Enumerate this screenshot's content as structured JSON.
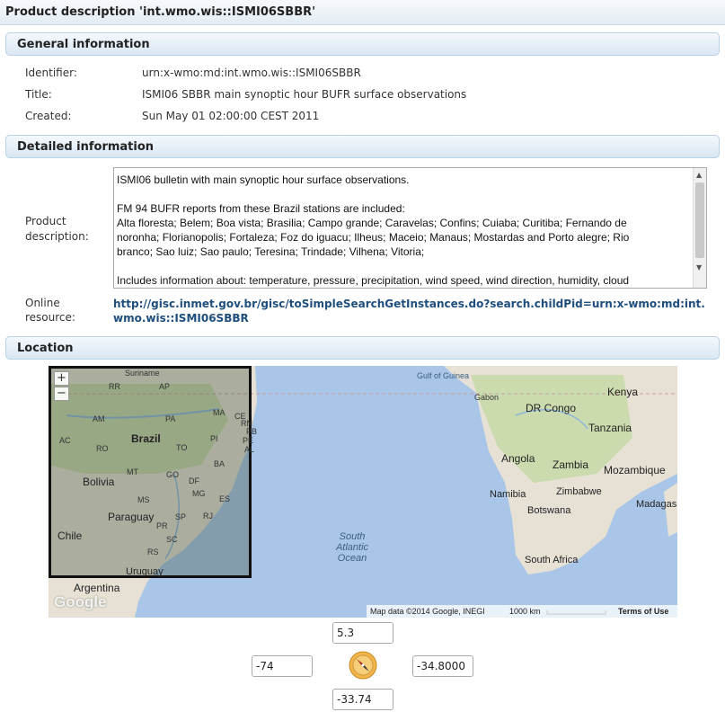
{
  "page": {
    "title": "Product description 'int.wmo.wis::ISMI06SBBR'"
  },
  "general": {
    "heading": "General information",
    "identifier_label": "Identifier:",
    "identifier_value": "urn:x-wmo:md:int.wmo.wis::ISMI06SBBR",
    "title_label": "Title:",
    "title_value": "ISMI06 SBBR main synoptic hour BUFR surface observations",
    "created_label": "Created:",
    "created_value": "Sun May 01 02:00:00 CEST 2011"
  },
  "detailed": {
    "heading": "Detailed information",
    "description_label_1": "Product",
    "description_label_2": "description:",
    "description_lines": [
      "ISMI06 bulletin with main synoptic hour surface observations.",
      "",
      "FM 94 BUFR reports from these Brazil stations are included:",
      "Alta floresta; Belem; Boa vista; Brasilia; Campo grande; Caravelas; Confins; Cuiaba; Curitiba; Fernando de",
      "noronha; Florianopolis; Fortaleza; Foz do iguacu; Ilheus; Maceio; Manaus; Mostardas and Porto alegre; Rio",
      "branco; Sao luiz; Sao paulo; Teresina; Trindade; Vilhena; Vitoria;",
      "",
      "Includes information about: temperature, pressure, precipitation, wind speed, wind direction, humidity, cloud"
    ],
    "online_label_1": "Online",
    "online_label_2": "resource:",
    "online_url": "http://gisc.inmet.gov.br/gisc/toSimpleSearchGetInstances.do?search.childPid=urn:x-wmo:md:int.wmo.wis::ISMI06SBBR"
  },
  "location": {
    "heading": "Location",
    "map": {
      "labels": {
        "suriname": "Suriname",
        "rr": "RR",
        "ap": "AP",
        "am": "AM",
        "pa": "PA",
        "ma": "MA",
        "ce": "CE",
        "rn": "RN",
        "pb": "PB",
        "pe": "PE",
        "al": "AL",
        "brazil": "Brazil",
        "ac": "AC",
        "ro": "RO",
        "to": "TO",
        "pi": "PI",
        "ba": "BA",
        "mt": "MT",
        "go": "GO",
        "df": "DF",
        "mg": "MG",
        "es": "ES",
        "ms": "MS",
        "sp": "SP",
        "rj": "RJ",
        "pr": "PR",
        "sc": "SC",
        "rs": "RS",
        "bolivia": "Bolivia",
        "paraguay": "Paraguay",
        "chile": "Chile",
        "uruguay": "Uruguay",
        "argentina": "Argentina",
        "gulf_of_guinea": "Gulf of Guinea",
        "gabon": "Gabon",
        "kenya": "Kenya",
        "dr_congo": "DR Congo",
        "tanzania": "Tanzania",
        "angola": "Angola",
        "zambia": "Zambia",
        "mozambique": "Mozambique",
        "namibia": "Namibia",
        "zimbabwe": "Zimbabwe",
        "botswana": "Botswana",
        "madagascar": "Madagas",
        "south_africa": "South Africa",
        "ocean_1": "South",
        "ocean_2": "Atlantic",
        "ocean_3": "Ocean"
      },
      "zoom_in": "+",
      "zoom_out": "−",
      "google": "Google",
      "attribution": "Map data ©2014 Google, INEGI",
      "scale": "1000 km",
      "terms": "Terms of Use"
    },
    "north": "5.3",
    "west": "-74",
    "east": "-34.8000",
    "south": "-33.74"
  },
  "colors": {
    "water": "#a9c6e8",
    "land": "#e9e5dc",
    "land_green": "#c7d9a8",
    "link": "#1d4e7e",
    "section_border": "#b9d0e6"
  },
  "icons": {
    "compass": "compass-icon",
    "scroll_up": "scroll-up-icon",
    "scroll_down": "scroll-down-icon"
  }
}
